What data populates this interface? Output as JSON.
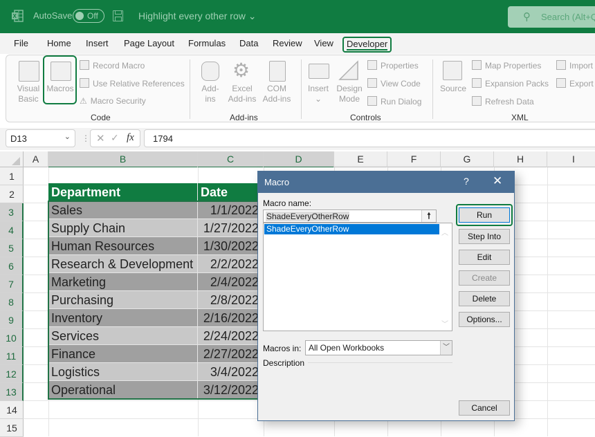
{
  "titlebar": {
    "app_icon": "excel-icon",
    "autosave_label": "AutoSave",
    "autosave_state": "Off",
    "save_icon": "save-icon",
    "document_title": "Highlight every other row",
    "title_chevron": "⌄",
    "search_icon": "⚲",
    "search_placeholder": "Search (Alt+Q)"
  },
  "menu": {
    "tabs": [
      "File",
      "Home",
      "Insert",
      "Page Layout",
      "Formulas",
      "Data",
      "Review",
      "View",
      "Developer"
    ],
    "active_tab": "Developer"
  },
  "ribbon": {
    "groups": [
      {
        "label": "Code",
        "large_buttons": [
          {
            "line1": "Visual",
            "line2": "Basic"
          },
          {
            "line1": "Macros",
            "line2": ""
          }
        ],
        "small_buttons": [
          "Record Macro",
          "Use Relative References",
          "Macro Security"
        ]
      },
      {
        "label": "Add-ins",
        "large_buttons": [
          {
            "line1": "Add-",
            "line2": "ins"
          },
          {
            "line1": "Excel",
            "line2": "Add-ins"
          },
          {
            "line1": "COM",
            "line2": "Add-ins"
          }
        ]
      },
      {
        "label": "Controls",
        "large_buttons": [
          {
            "line1": "Insert",
            "line2": "⌄"
          },
          {
            "line1": "Design",
            "line2": "Mode"
          }
        ],
        "small_buttons": [
          "Properties",
          "View Code",
          "Run Dialog"
        ]
      },
      {
        "label": "XML",
        "large_buttons": [
          {
            "line1": "Source",
            "line2": ""
          }
        ],
        "small_buttons": [
          "Map Properties",
          "Expansion Packs",
          "Refresh Data",
          "Import",
          "Export"
        ]
      }
    ]
  },
  "formula_bar": {
    "name_box": "D13",
    "cancel_icon": "✕",
    "enter_icon": "✓",
    "fx_label": "fx",
    "value": "1794"
  },
  "sheet": {
    "columns": [
      "A",
      "B",
      "C",
      "D",
      "E",
      "F",
      "G",
      "H",
      "I"
    ],
    "selected_columns": [
      "B",
      "C",
      "D"
    ],
    "rows": [
      "1",
      "2",
      "3",
      "4",
      "5",
      "6",
      "7",
      "8",
      "9",
      "10",
      "11",
      "12",
      "13",
      "14",
      "15"
    ],
    "selected_rows": [
      "3",
      "4",
      "5",
      "6",
      "7",
      "8",
      "9",
      "10",
      "11",
      "12",
      "13"
    ],
    "table": {
      "headers": [
        "Department",
        "Date"
      ],
      "rows": [
        {
          "department": "Sales",
          "date": "1/1/2022"
        },
        {
          "department": "Supply Chain",
          "date": "1/27/2022"
        },
        {
          "department": "Human Resources",
          "date": "1/30/2022"
        },
        {
          "department": "Research & Development",
          "date": "2/2/2022"
        },
        {
          "department": "Marketing",
          "date": "2/4/2022"
        },
        {
          "department": "Purchasing",
          "date": "2/8/2022"
        },
        {
          "department": "Inventory",
          "date": "2/16/2022"
        },
        {
          "department": "Services",
          "date": "2/24/2022"
        },
        {
          "department": "Finance",
          "date": "2/27/2022"
        },
        {
          "department": "Logistics",
          "date": "3/4/2022"
        },
        {
          "department": "Operational",
          "date": "3/12/2022"
        }
      ]
    },
    "colors": {
      "header_bg": "#107c41",
      "row_dark": "#a0a0a0",
      "row_light": "#c8c8c8"
    }
  },
  "dialog": {
    "title": "Macro",
    "help_icon": "?",
    "close_icon": "✕",
    "macro_name_label": "Macro name:",
    "macro_name_value": "ShadeEveryOtherRow",
    "macro_list": [
      "ShadeEveryOtherRow"
    ],
    "selected_macro": "ShadeEveryOtherRow",
    "buttons": {
      "run": "Run",
      "step_into": "Step Into",
      "edit": "Edit",
      "create": "Create",
      "delete": "Delete",
      "options": "Options...",
      "cancel": "Cancel"
    },
    "macros_in_label": "Macros in:",
    "macros_in_value": "All Open Workbooks",
    "description_label": "Description"
  }
}
